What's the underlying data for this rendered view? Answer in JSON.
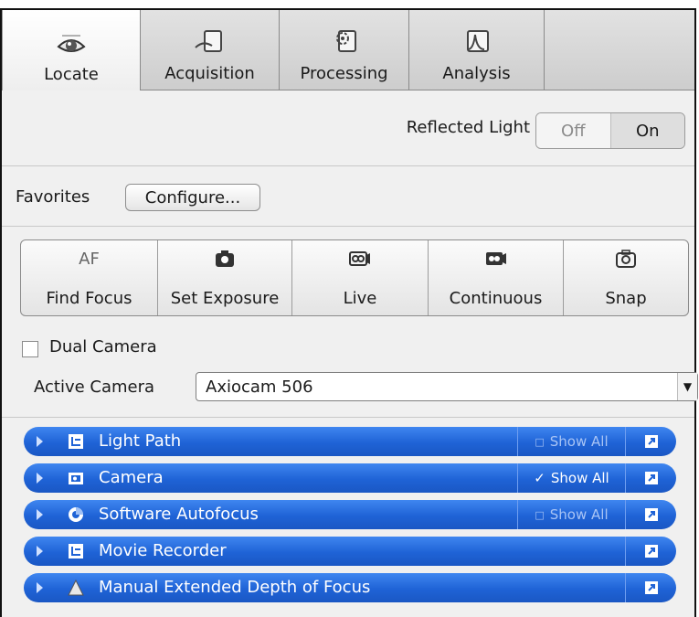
{
  "tabs": [
    {
      "label": "Locate",
      "icon": "eye-icon",
      "active": true
    },
    {
      "label": "Acquisition",
      "icon": "microscope-stage-icon",
      "active": false
    },
    {
      "label": "Processing",
      "icon": "gear-processing-icon",
      "active": false
    },
    {
      "label": "Analysis",
      "icon": "peak-chart-icon",
      "active": false
    }
  ],
  "reflected_light": {
    "label": "Reflected Light",
    "off": "Off",
    "on": "On",
    "selected": "On"
  },
  "favorites": {
    "label": "Favorites",
    "configure": "Configure..."
  },
  "actions": [
    {
      "label": "Find Focus",
      "icon_text": "AF",
      "icon": "autofocus-icon"
    },
    {
      "label": "Set Exposure",
      "icon": "exposure-camera-icon"
    },
    {
      "label": "Live",
      "icon": "live-camera-icon"
    },
    {
      "label": "Continuous",
      "icon": "continuous-camera-icon"
    },
    {
      "label": "Snap",
      "icon": "snap-camera-icon"
    }
  ],
  "dual_camera": {
    "label": "Dual Camera",
    "checked": false
  },
  "active_camera": {
    "label": "Active Camera",
    "value": "Axiocam 506"
  },
  "panels": [
    {
      "title": "Light Path",
      "icon": "light-path-icon",
      "show_all": "Show All",
      "show_all_checked": false
    },
    {
      "title": "Camera",
      "icon": "camera-tool-icon",
      "show_all": "Show All",
      "show_all_checked": true
    },
    {
      "title": "Software Autofocus",
      "icon": "autofocus-ring-icon",
      "show_all": "Show All",
      "show_all_checked": false
    },
    {
      "title": "Movie Recorder",
      "icon": "movie-recorder-icon",
      "show_all": "",
      "show_all_checked": false
    },
    {
      "title": "Manual Extended Depth of Focus",
      "icon": "depth-of-focus-icon",
      "show_all": "",
      "show_all_checked": false
    }
  ],
  "colors": {
    "panel_blue": "#1f63d6",
    "tab_bg": "#d6d6d6",
    "window_bg": "#f0f0f0"
  }
}
